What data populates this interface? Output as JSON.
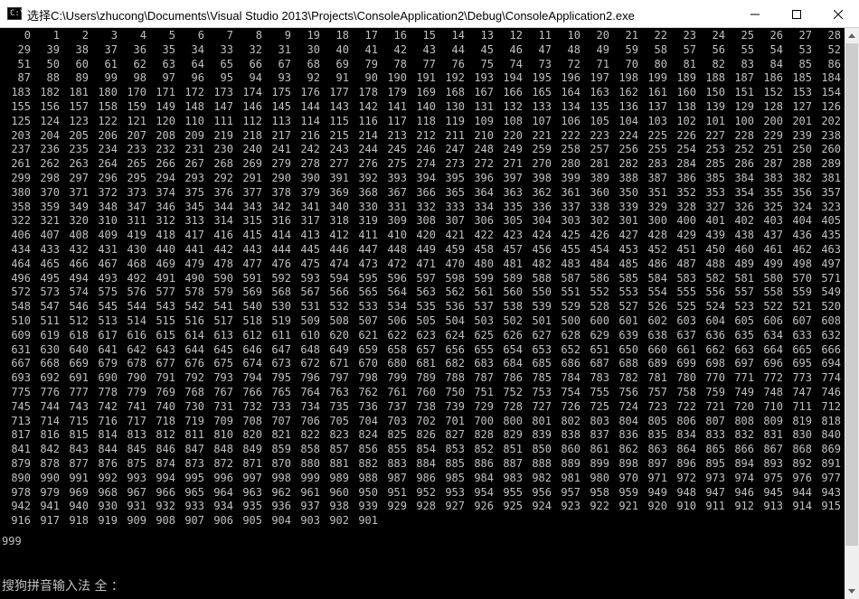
{
  "window": {
    "title": "选择C:\\Users\\zhucong\\Documents\\Visual Studio 2013\\Projects\\ConsoleApplication2\\Debug\\ConsoleApplication2.exe",
    "icon_label": "C:\\",
    "controls": [
      "minimize-icon",
      "maximize-icon",
      "close-icon"
    ]
  },
  "console": {
    "rows": [
      [
        "0",
        "1",
        "2",
        "3",
        "4",
        "5",
        "6",
        "7",
        "8",
        "9",
        "19",
        "18",
        "17",
        "16",
        "15",
        "14",
        "13",
        "12",
        "11",
        "10",
        "20",
        "21",
        "22",
        "23",
        "24",
        "25",
        "26",
        "27",
        "28"
      ],
      [
        "29",
        "39",
        "38",
        "37",
        "36",
        "35",
        "34",
        "33",
        "32",
        "31",
        "30",
        "40",
        "41",
        "42",
        "43",
        "44",
        "45",
        "46",
        "47",
        "48",
        "49",
        "59",
        "58",
        "57",
        "56",
        "55",
        "54",
        "53",
        "52"
      ],
      [
        "51",
        "50",
        "60",
        "61",
        "62",
        "63",
        "64",
        "65",
        "66",
        "67",
        "68",
        "69",
        "79",
        "78",
        "77",
        "76",
        "75",
        "74",
        "73",
        "72",
        "71",
        "70",
        "80",
        "81",
        "82",
        "83",
        "84",
        "85",
        "86"
      ],
      [
        "87",
        "88",
        "89",
        "99",
        "98",
        "97",
        "96",
        "95",
        "94",
        "93",
        "92",
        "91",
        "90",
        "190",
        "191",
        "192",
        "193",
        "194",
        "195",
        "196",
        "197",
        "198",
        "199",
        "189",
        "188",
        "187",
        "186",
        "185",
        "184"
      ],
      [
        "183",
        "182",
        "181",
        "180",
        "170",
        "171",
        "172",
        "173",
        "174",
        "175",
        "176",
        "177",
        "178",
        "179",
        "169",
        "168",
        "167",
        "166",
        "165",
        "164",
        "163",
        "162",
        "161",
        "160",
        "150",
        "151",
        "152",
        "153",
        "154"
      ],
      [
        "155",
        "156",
        "157",
        "158",
        "159",
        "149",
        "148",
        "147",
        "146",
        "145",
        "144",
        "143",
        "142",
        "141",
        "140",
        "130",
        "131",
        "132",
        "133",
        "134",
        "135",
        "136",
        "137",
        "138",
        "139",
        "129",
        "128",
        "127",
        "126"
      ],
      [
        "125",
        "124",
        "123",
        "122",
        "121",
        "120",
        "110",
        "111",
        "112",
        "113",
        "114",
        "115",
        "116",
        "117",
        "118",
        "119",
        "109",
        "108",
        "107",
        "106",
        "105",
        "104",
        "103",
        "102",
        "101",
        "100",
        "200",
        "201",
        "202"
      ],
      [
        "203",
        "204",
        "205",
        "206",
        "207",
        "208",
        "209",
        "219",
        "218",
        "217",
        "216",
        "215",
        "214",
        "213",
        "212",
        "211",
        "210",
        "220",
        "221",
        "222",
        "223",
        "224",
        "225",
        "226",
        "227",
        "228",
        "229",
        "239",
        "238"
      ],
      [
        "237",
        "236",
        "235",
        "234",
        "233",
        "232",
        "231",
        "230",
        "240",
        "241",
        "242",
        "243",
        "244",
        "245",
        "246",
        "247",
        "248",
        "249",
        "259",
        "258",
        "257",
        "256",
        "255",
        "254",
        "253",
        "252",
        "251",
        "250",
        "260"
      ],
      [
        "261",
        "262",
        "263",
        "264",
        "265",
        "266",
        "267",
        "268",
        "269",
        "279",
        "278",
        "277",
        "276",
        "275",
        "274",
        "273",
        "272",
        "271",
        "270",
        "280",
        "281",
        "282",
        "283",
        "284",
        "285",
        "286",
        "287",
        "288",
        "289"
      ],
      [
        "299",
        "298",
        "297",
        "296",
        "295",
        "294",
        "293",
        "292",
        "291",
        "290",
        "390",
        "391",
        "392",
        "393",
        "394",
        "395",
        "396",
        "397",
        "398",
        "399",
        "389",
        "388",
        "387",
        "386",
        "385",
        "384",
        "383",
        "382",
        "381"
      ],
      [
        "380",
        "370",
        "371",
        "372",
        "373",
        "374",
        "375",
        "376",
        "377",
        "378",
        "379",
        "369",
        "368",
        "367",
        "366",
        "365",
        "364",
        "363",
        "362",
        "361",
        "360",
        "350",
        "351",
        "352",
        "353",
        "354",
        "355",
        "356",
        "357"
      ],
      [
        "358",
        "359",
        "349",
        "348",
        "347",
        "346",
        "345",
        "344",
        "343",
        "342",
        "341",
        "340",
        "330",
        "331",
        "332",
        "333",
        "334",
        "335",
        "336",
        "337",
        "338",
        "339",
        "329",
        "328",
        "327",
        "326",
        "325",
        "324",
        "323"
      ],
      [
        "322",
        "321",
        "320",
        "310",
        "311",
        "312",
        "313",
        "314",
        "315",
        "316",
        "317",
        "318",
        "319",
        "309",
        "308",
        "307",
        "306",
        "305",
        "304",
        "303",
        "302",
        "301",
        "300",
        "400",
        "401",
        "402",
        "403",
        "404",
        "405"
      ],
      [
        "406",
        "407",
        "408",
        "409",
        "419",
        "418",
        "417",
        "416",
        "415",
        "414",
        "413",
        "412",
        "411",
        "410",
        "420",
        "421",
        "422",
        "423",
        "424",
        "425",
        "426",
        "427",
        "428",
        "429",
        "439",
        "438",
        "437",
        "436",
        "435"
      ],
      [
        "434",
        "433",
        "432",
        "431",
        "430",
        "440",
        "441",
        "442",
        "443",
        "444",
        "445",
        "446",
        "447",
        "448",
        "449",
        "459",
        "458",
        "457",
        "456",
        "455",
        "454",
        "453",
        "452",
        "451",
        "450",
        "460",
        "461",
        "462",
        "463"
      ],
      [
        "464",
        "465",
        "466",
        "467",
        "468",
        "469",
        "479",
        "478",
        "477",
        "476",
        "475",
        "474",
        "473",
        "472",
        "471",
        "470",
        "480",
        "481",
        "482",
        "483",
        "484",
        "485",
        "486",
        "487",
        "488",
        "489",
        "499",
        "498",
        "497"
      ],
      [
        "496",
        "495",
        "494",
        "493",
        "492",
        "491",
        "490",
        "590",
        "591",
        "592",
        "593",
        "594",
        "595",
        "596",
        "597",
        "598",
        "599",
        "589",
        "588",
        "587",
        "586",
        "585",
        "584",
        "583",
        "582",
        "581",
        "580",
        "570",
        "571"
      ],
      [
        "572",
        "573",
        "574",
        "575",
        "576",
        "577",
        "578",
        "579",
        "569",
        "568",
        "567",
        "566",
        "565",
        "564",
        "563",
        "562",
        "561",
        "560",
        "550",
        "551",
        "552",
        "553",
        "554",
        "555",
        "556",
        "557",
        "558",
        "559",
        "549"
      ],
      [
        "548",
        "547",
        "546",
        "545",
        "544",
        "543",
        "542",
        "541",
        "540",
        "530",
        "531",
        "532",
        "533",
        "534",
        "535",
        "536",
        "537",
        "538",
        "539",
        "529",
        "528",
        "527",
        "526",
        "525",
        "524",
        "523",
        "522",
        "521",
        "520"
      ],
      [
        "510",
        "511",
        "512",
        "513",
        "514",
        "515",
        "516",
        "517",
        "518",
        "519",
        "509",
        "508",
        "507",
        "506",
        "505",
        "504",
        "503",
        "502",
        "501",
        "500",
        "600",
        "601",
        "602",
        "603",
        "604",
        "605",
        "606",
        "607",
        "608"
      ],
      [
        "609",
        "619",
        "618",
        "617",
        "616",
        "615",
        "614",
        "613",
        "612",
        "611",
        "610",
        "620",
        "621",
        "622",
        "623",
        "624",
        "625",
        "626",
        "627",
        "628",
        "629",
        "639",
        "638",
        "637",
        "636",
        "635",
        "634",
        "633",
        "632"
      ],
      [
        "631",
        "630",
        "640",
        "641",
        "642",
        "643",
        "644",
        "645",
        "646",
        "647",
        "648",
        "649",
        "659",
        "658",
        "657",
        "656",
        "655",
        "654",
        "653",
        "652",
        "651",
        "650",
        "660",
        "661",
        "662",
        "663",
        "664",
        "665",
        "666"
      ],
      [
        "667",
        "668",
        "669",
        "679",
        "678",
        "677",
        "676",
        "675",
        "674",
        "673",
        "672",
        "671",
        "670",
        "680",
        "681",
        "682",
        "683",
        "684",
        "685",
        "686",
        "687",
        "688",
        "689",
        "699",
        "698",
        "697",
        "696",
        "695",
        "694"
      ],
      [
        "693",
        "692",
        "691",
        "690",
        "790",
        "791",
        "792",
        "793",
        "794",
        "795",
        "796",
        "797",
        "798",
        "799",
        "789",
        "788",
        "787",
        "786",
        "785",
        "784",
        "783",
        "782",
        "781",
        "780",
        "770",
        "771",
        "772",
        "773",
        "774"
      ],
      [
        "775",
        "776",
        "777",
        "778",
        "779",
        "769",
        "768",
        "767",
        "766",
        "765",
        "764",
        "763",
        "762",
        "761",
        "760",
        "750",
        "751",
        "752",
        "753",
        "754",
        "755",
        "756",
        "757",
        "758",
        "759",
        "749",
        "748",
        "747",
        "746"
      ],
      [
        "745",
        "744",
        "743",
        "742",
        "741",
        "740",
        "730",
        "731",
        "732",
        "733",
        "734",
        "735",
        "736",
        "737",
        "738",
        "739",
        "729",
        "728",
        "727",
        "726",
        "725",
        "724",
        "723",
        "722",
        "721",
        "720",
        "710",
        "711",
        "712"
      ],
      [
        "713",
        "714",
        "715",
        "716",
        "717",
        "718",
        "719",
        "709",
        "708",
        "707",
        "706",
        "705",
        "704",
        "703",
        "702",
        "701",
        "700",
        "800",
        "801",
        "802",
        "803",
        "804",
        "805",
        "806",
        "807",
        "808",
        "809",
        "819",
        "818"
      ],
      [
        "817",
        "816",
        "815",
        "814",
        "813",
        "812",
        "811",
        "810",
        "820",
        "821",
        "822",
        "823",
        "824",
        "825",
        "826",
        "827",
        "828",
        "829",
        "839",
        "838",
        "837",
        "836",
        "835",
        "834",
        "833",
        "832",
        "831",
        "830",
        "840"
      ],
      [
        "841",
        "842",
        "843",
        "844",
        "845",
        "846",
        "847",
        "848",
        "849",
        "859",
        "858",
        "857",
        "856",
        "855",
        "854",
        "853",
        "852",
        "851",
        "850",
        "860",
        "861",
        "862",
        "863",
        "864",
        "865",
        "866",
        "867",
        "868",
        "869"
      ],
      [
        "879",
        "878",
        "877",
        "876",
        "875",
        "874",
        "873",
        "872",
        "871",
        "870",
        "880",
        "881",
        "882",
        "883",
        "884",
        "885",
        "886",
        "887",
        "888",
        "889",
        "899",
        "898",
        "897",
        "896",
        "895",
        "894",
        "893",
        "892",
        "891"
      ],
      [
        "890",
        "990",
        "991",
        "992",
        "993",
        "994",
        "995",
        "996",
        "997",
        "998",
        "999",
        "989",
        "988",
        "987",
        "986",
        "985",
        "984",
        "983",
        "982",
        "981",
        "980",
        "970",
        "971",
        "972",
        "973",
        "974",
        "975",
        "976",
        "977"
      ],
      [
        "978",
        "979",
        "969",
        "968",
        "967",
        "966",
        "965",
        "964",
        "963",
        "962",
        "961",
        "960",
        "950",
        "951",
        "952",
        "953",
        "954",
        "955",
        "956",
        "957",
        "958",
        "959",
        "949",
        "948",
        "947",
        "946",
        "945",
        "944",
        "943"
      ],
      [
        "942",
        "941",
        "940",
        "930",
        "931",
        "932",
        "933",
        "934",
        "935",
        "936",
        "937",
        "938",
        "939",
        "929",
        "928",
        "927",
        "926",
        "925",
        "924",
        "923",
        "922",
        "921",
        "920",
        "910",
        "911",
        "912",
        "913",
        "914",
        "915"
      ],
      [
        "916",
        "917",
        "918",
        "919",
        "909",
        "908",
        "907",
        "906",
        "905",
        "904",
        "903",
        "902",
        "901"
      ]
    ],
    "final_output": "999",
    "ime_status": "搜狗拼音输入法 全 ："
  },
  "scrollbar": {
    "position_fraction": 0.0,
    "visible_fraction": 0.93
  }
}
